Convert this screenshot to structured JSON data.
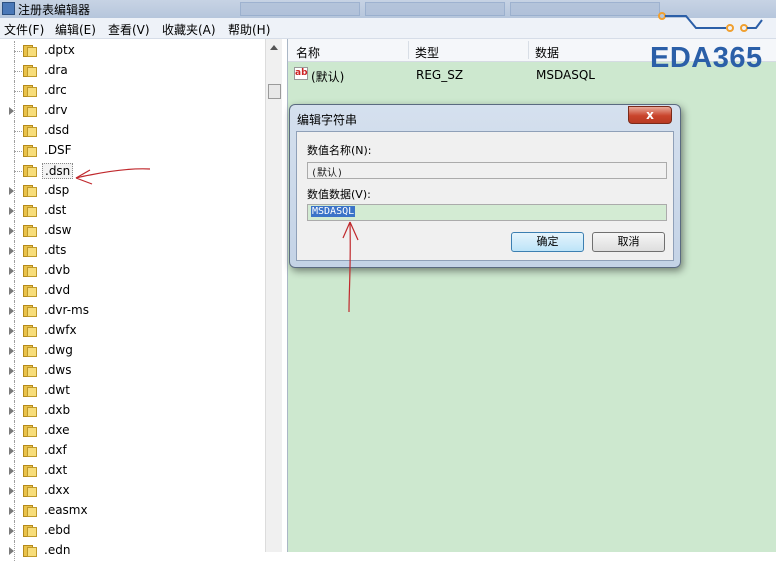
{
  "window": {
    "title": "注册表编辑器"
  },
  "menubar": {
    "items": [
      "文件(F)",
      "编辑(E)",
      "查看(V)",
      "收藏夹(A)",
      "帮助(H)"
    ]
  },
  "tree": {
    "items": [
      {
        "label": ".dptx",
        "expandable": false
      },
      {
        "label": ".dra",
        "expandable": false
      },
      {
        "label": ".drc",
        "expandable": false
      },
      {
        "label": ".drv",
        "expandable": true
      },
      {
        "label": ".dsd",
        "expandable": false
      },
      {
        "label": ".DSF",
        "expandable": false
      },
      {
        "label": ".dsn",
        "expandable": false,
        "selected": true
      },
      {
        "label": ".dsp",
        "expandable": true
      },
      {
        "label": ".dst",
        "expandable": true
      },
      {
        "label": ".dsw",
        "expandable": true
      },
      {
        "label": ".dts",
        "expandable": true
      },
      {
        "label": ".dvb",
        "expandable": true
      },
      {
        "label": ".dvd",
        "expandable": true
      },
      {
        "label": ".dvr-ms",
        "expandable": true
      },
      {
        "label": ".dwfx",
        "expandable": true
      },
      {
        "label": ".dwg",
        "expandable": true
      },
      {
        "label": ".dws",
        "expandable": true
      },
      {
        "label": ".dwt",
        "expandable": true
      },
      {
        "label": ".dxb",
        "expandable": true
      },
      {
        "label": ".dxe",
        "expandable": true
      },
      {
        "label": ".dxf",
        "expandable": true
      },
      {
        "label": ".dxt",
        "expandable": true
      },
      {
        "label": ".dxx",
        "expandable": true
      },
      {
        "label": ".easmx",
        "expandable": true
      },
      {
        "label": ".ebd",
        "expandable": true
      },
      {
        "label": ".edn",
        "expandable": true
      }
    ]
  },
  "list": {
    "columns": {
      "name": "名称",
      "type": "类型",
      "data": "数据"
    },
    "rows": [
      {
        "icon": "ab",
        "name": "(默认)",
        "type": "REG_SZ",
        "data": "MSDASQL"
      }
    ]
  },
  "logo": {
    "text": "EDA365"
  },
  "dialog": {
    "title": "编辑字符串",
    "close_glyph": "x",
    "value_name_label": "数值名称(N):",
    "value_name": "(默认)",
    "value_data_label": "数值数据(V):",
    "value_data": "MSDASQL",
    "ok_label": "确定",
    "cancel_label": "取消"
  },
  "colors": {
    "list_background": "#cde8cf",
    "annotation_red": "#c0282c",
    "logo_blue": "#2b5fa8",
    "logo_orange": "#f0a030",
    "selection_blue": "#3b73c8"
  }
}
